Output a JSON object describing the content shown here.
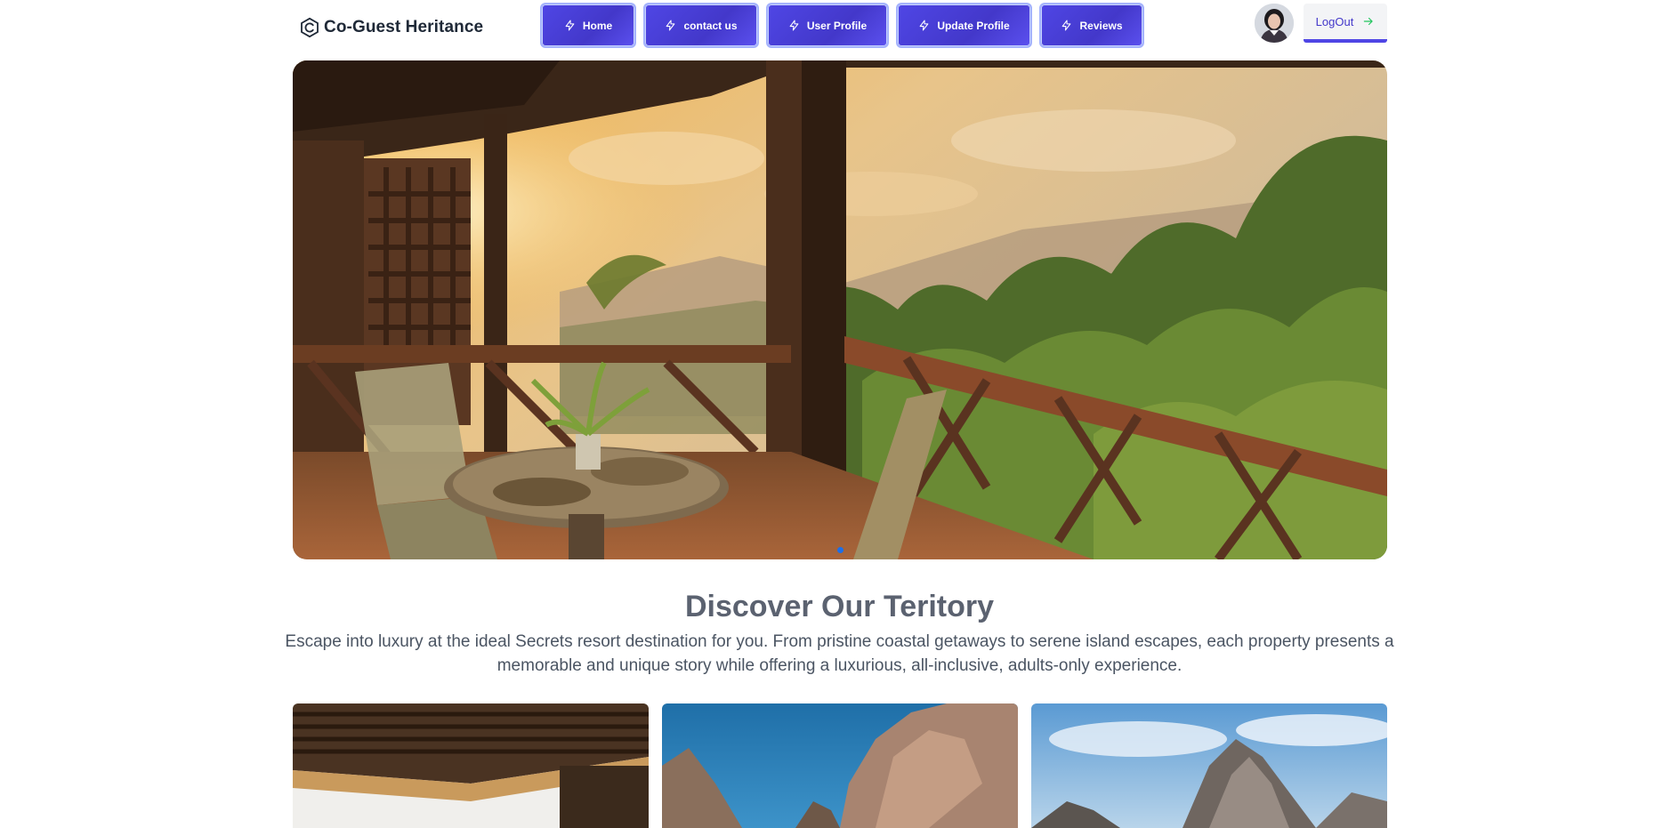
{
  "brand": {
    "name": "Co-Guest Heritance",
    "icon": "hexagon-c-logo-icon"
  },
  "nav": {
    "icon": "lightning-bolt-icon",
    "accent_color": "#4f46e5",
    "items": [
      {
        "label": "Home"
      },
      {
        "label": "contact us"
      },
      {
        "label": "User Profile"
      },
      {
        "label": "Update Profile"
      },
      {
        "label": "Reviews"
      }
    ]
  },
  "user": {
    "avatar": "user-avatar",
    "logout_label": "LogOut",
    "logout_icon": "arrow-right-icon",
    "logout_arrow_color": "#22c55e"
  },
  "hero": {
    "image": "balcony-sunset-rainforest-view",
    "slide_indicator_color": "#1d6fe8"
  },
  "section": {
    "title": "Discover Our Teritory",
    "description": "Escape into luxury at the ideal Secrets resort destination for you. From pristine coastal getaways to serene island escapes, each property presents a memorable and unique story while offering a luxurious, all-inclusive, adults-only experience."
  },
  "cards": [
    {
      "image": "wooden-pergola-ceiling"
    },
    {
      "image": "rock-arch-blue-sky"
    },
    {
      "image": "rocky-coast-cloudy-sky"
    }
  ]
}
